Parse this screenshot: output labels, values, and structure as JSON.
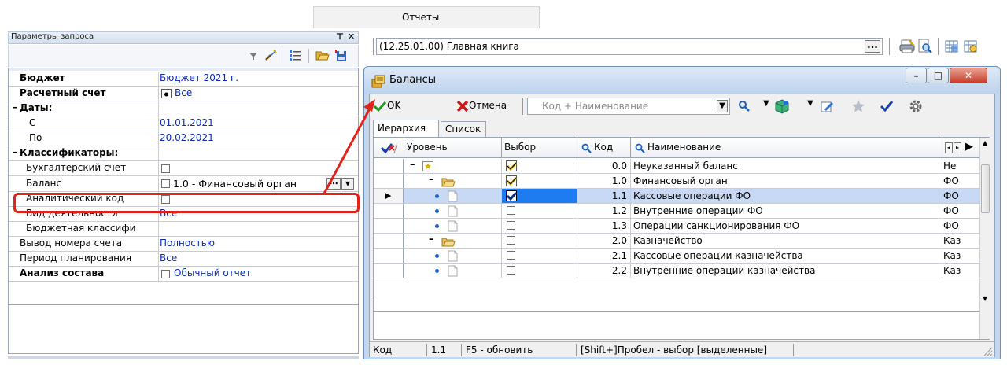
{
  "top_tab": {
    "label": "Отчеты"
  },
  "left_panel": {
    "title": "Параметры запроса",
    "pin_glyph": "⊤",
    "close_glyph": "✕",
    "params": [
      {
        "label": "Бюджет",
        "value": "Бюджет 2021 г."
      },
      {
        "label": "Расчетный счет",
        "value": "Все"
      },
      {
        "label": "Даты:"
      },
      {
        "label": "С",
        "value": "01.01.2021"
      },
      {
        "label": "По",
        "value": "20.02.2021"
      },
      {
        "label": "Классификаторы:"
      },
      {
        "label": "Бухгалтерский счет"
      },
      {
        "label": "Баланс",
        "value": "1.0 - Финансовый орган",
        "ellipsis": "⋯",
        "dropdown": "▾"
      },
      {
        "label": "Аналитический код"
      },
      {
        "label": "Вид деятельности",
        "value": "Все"
      },
      {
        "label": "Бюджетная классифи"
      },
      {
        "label": "Вывод номера счета",
        "value": "Полностью"
      },
      {
        "label": "Период планирования",
        "value": "Все"
      },
      {
        "label": "Анализ состава",
        "value": "Обычный отчет"
      }
    ]
  },
  "report": {
    "name": "(12.25.01.00) Главная книга",
    "browse": "..."
  },
  "dialog": {
    "title": "Балансы",
    "ok_label": "OK",
    "cancel_label": "Отмена",
    "search_placeholder": "Код + Наименование",
    "tabs": [
      {
        "label": "Иерархия"
      },
      {
        "label": "Список"
      }
    ],
    "columns": {
      "level": "Уровень",
      "choice": "Выбор",
      "code": "Код",
      "name": "Наименование"
    },
    "rows": [
      {
        "code": "0.0",
        "name": "Неуказанный баланс",
        "extra": "Не"
      },
      {
        "code": "1.0",
        "name": "Финансовый орган",
        "extra": "ФО"
      },
      {
        "code": "1.1",
        "name": "Кассовые операции ФО",
        "extra": "ФО"
      },
      {
        "code": "1.2",
        "name": "Внутренние операции ФО",
        "extra": "ФО"
      },
      {
        "code": "1.3",
        "name": "Операции санкционирования ФО",
        "extra": "ФО"
      },
      {
        "code": "2.0",
        "name": "Казначейство",
        "extra": "Каз"
      },
      {
        "code": "2.1",
        "name": "Кассовые операции казначейства",
        "extra": "Каз"
      },
      {
        "code": "2.2",
        "name": "Внутренние операции казначейства",
        "extra": "Каз"
      }
    ],
    "status": {
      "field": "Код",
      "value": "1.1",
      "hint_refresh": "F5 - обновить",
      "hint_select": "[Shift+]Пробел - выбор [выделенные]"
    },
    "window_buttons": {
      "minimize": "–",
      "maximize": "□",
      "close": "✕"
    }
  },
  "colors": {
    "highlight_red": "#e2231a",
    "link_blue": "#0a2bb5",
    "selected_row": "#c8d9f5"
  }
}
